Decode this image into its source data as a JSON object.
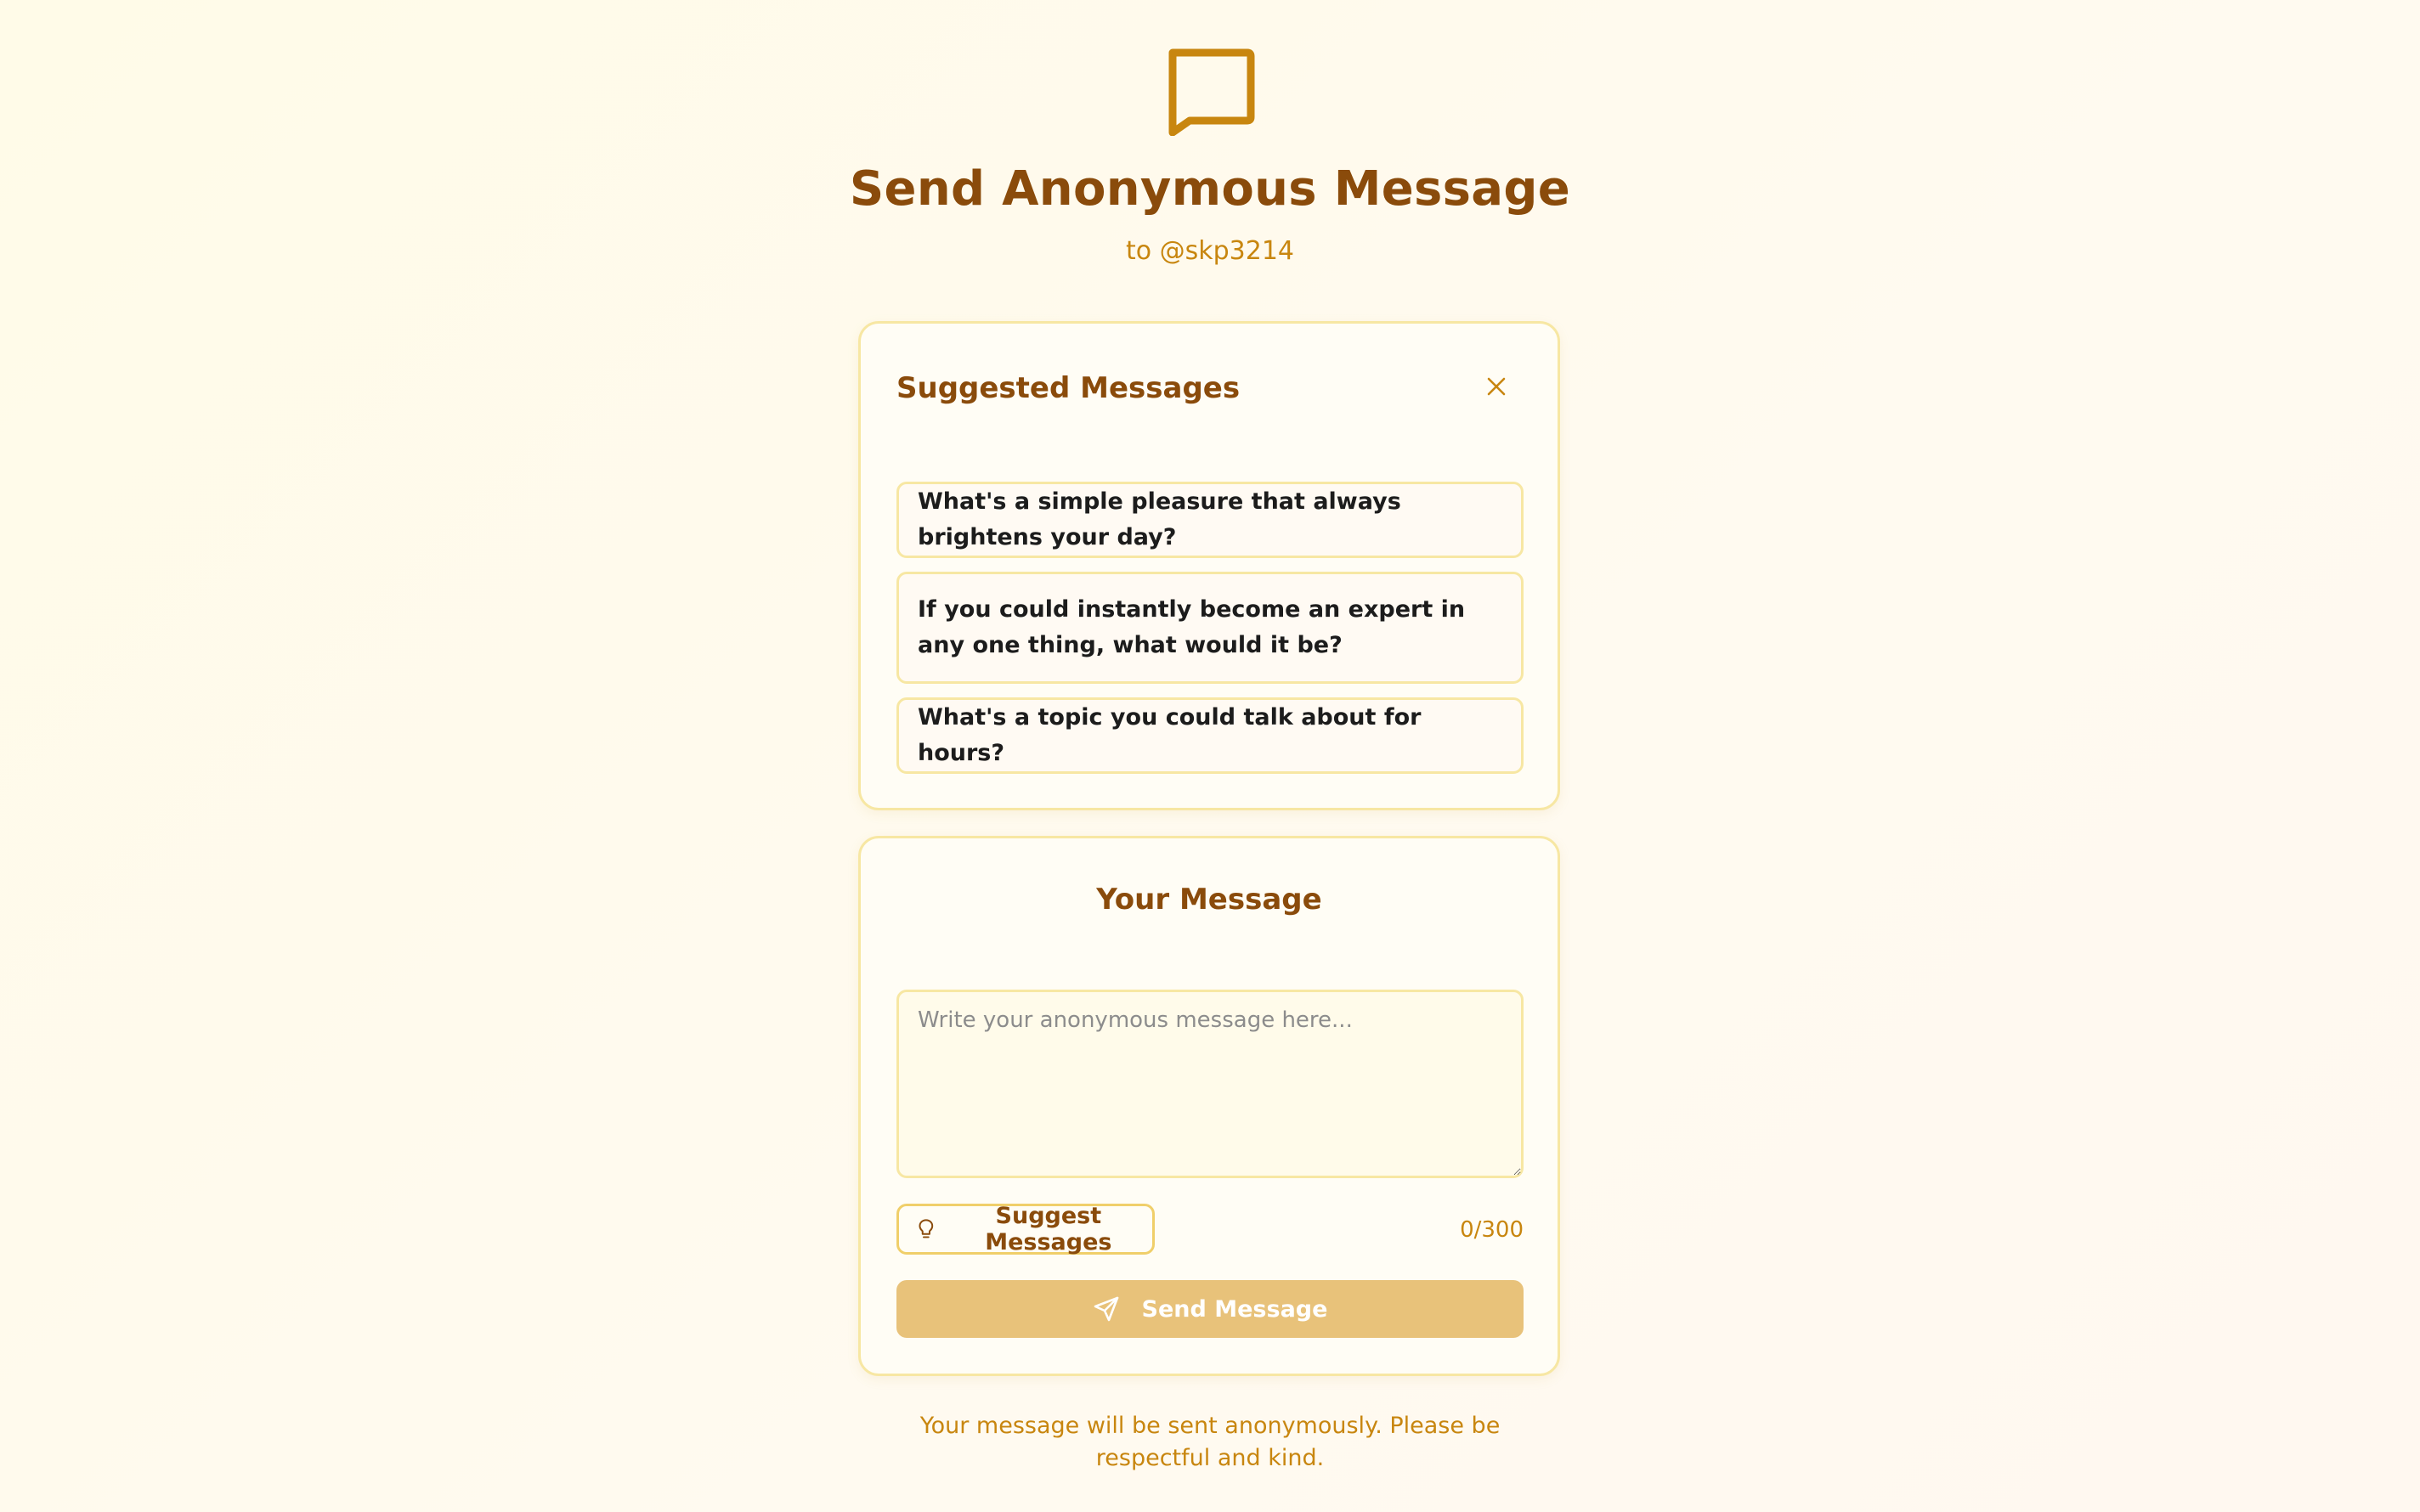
{
  "header": {
    "icon": "message-square-icon",
    "title": "Send Anonymous Message",
    "subtitle": "to @skp3214"
  },
  "suggestions": {
    "title": "Suggested Messages",
    "close_icon": "close-icon",
    "items": [
      "What's a simple pleasure that always brightens your day?",
      "If you could instantly become an expert in any one thing, what would it be?",
      "What's a topic you could talk about for hours?"
    ]
  },
  "message": {
    "title": "Your Message",
    "placeholder": "Write your anonymous message here...",
    "value": "",
    "suggest_button_label": "Suggest Messages",
    "suggest_button_icon": "lightbulb-icon",
    "char_count": "0/300",
    "send_button_label": "Send Message",
    "send_button_icon": "send-icon"
  },
  "footer": {
    "note": "Your message will be sent anonymously. Please be respectful and kind."
  },
  "colors": {
    "primary_text": "#8a4b0b",
    "accent": "#c8860f",
    "card_border": "#f7e7a3",
    "send_button_bg": "#e8c27a",
    "page_bg": "#fffbe8"
  }
}
